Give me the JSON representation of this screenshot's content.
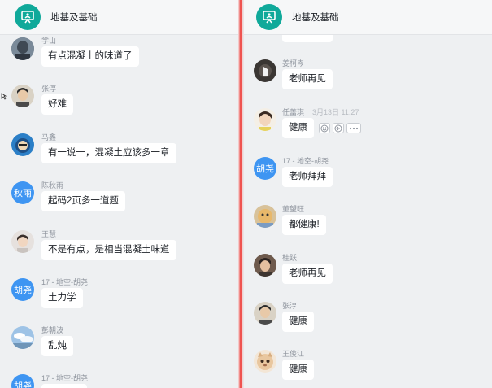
{
  "left": {
    "group_title": "地基及基础",
    "messages": [
      {
        "sender": "学山",
        "text": "有点混凝土的味道了",
        "avatar": "photo"
      },
      {
        "sender": "张淳",
        "text": "好难",
        "avatar": "photo"
      },
      {
        "sender": "马鑫",
        "text": "有一说一，混凝土应该多一章",
        "avatar": "photo"
      },
      {
        "sender": "陈秋雨",
        "text": "起码2页多一道题",
        "avatar_text": "秋雨"
      },
      {
        "sender": "王慧",
        "text": "不是有点，是相当混凝土味道",
        "avatar": "photo"
      },
      {
        "sender": "17 - 地空-胡尧",
        "text": "土力学",
        "avatar_text": "胡尧"
      },
      {
        "sender": "彭朝波",
        "text": "乱炖",
        "avatar": "photo"
      },
      {
        "sender": "17 - 地空-胡尧",
        "text": "",
        "avatar_text": "胡尧"
      }
    ]
  },
  "right": {
    "group_title": "地基及基础",
    "messages": [
      {
        "sender": "姜柯岑",
        "text": "老师再见",
        "avatar": "photo"
      },
      {
        "sender": "任蕾琪",
        "time": "3月13日 11:27",
        "text": "健康",
        "avatar": "photo"
      },
      {
        "sender": "17 - 地空-胡尧",
        "text": "老师拜拜",
        "avatar_text": "胡尧"
      },
      {
        "sender": "董望旺",
        "text": "都健康!",
        "avatar": "photo"
      },
      {
        "sender": "桂跃",
        "text": "老师再见",
        "avatar": "photo"
      },
      {
        "sender": "张淳",
        "text": "健康",
        "avatar": "photo"
      },
      {
        "sender": "王俊江",
        "text": "健康",
        "avatar": "photo"
      }
    ]
  },
  "icons": {
    "group": "classroom-board-icon",
    "emoji": "smile-icon",
    "reply": "reply-icon",
    "more": "more-icon"
  },
  "colors": {
    "group_icon": "#10a99a",
    "text_avatar": "#3e95f2",
    "divider": "#ef5350",
    "background": "#eef0f2"
  }
}
